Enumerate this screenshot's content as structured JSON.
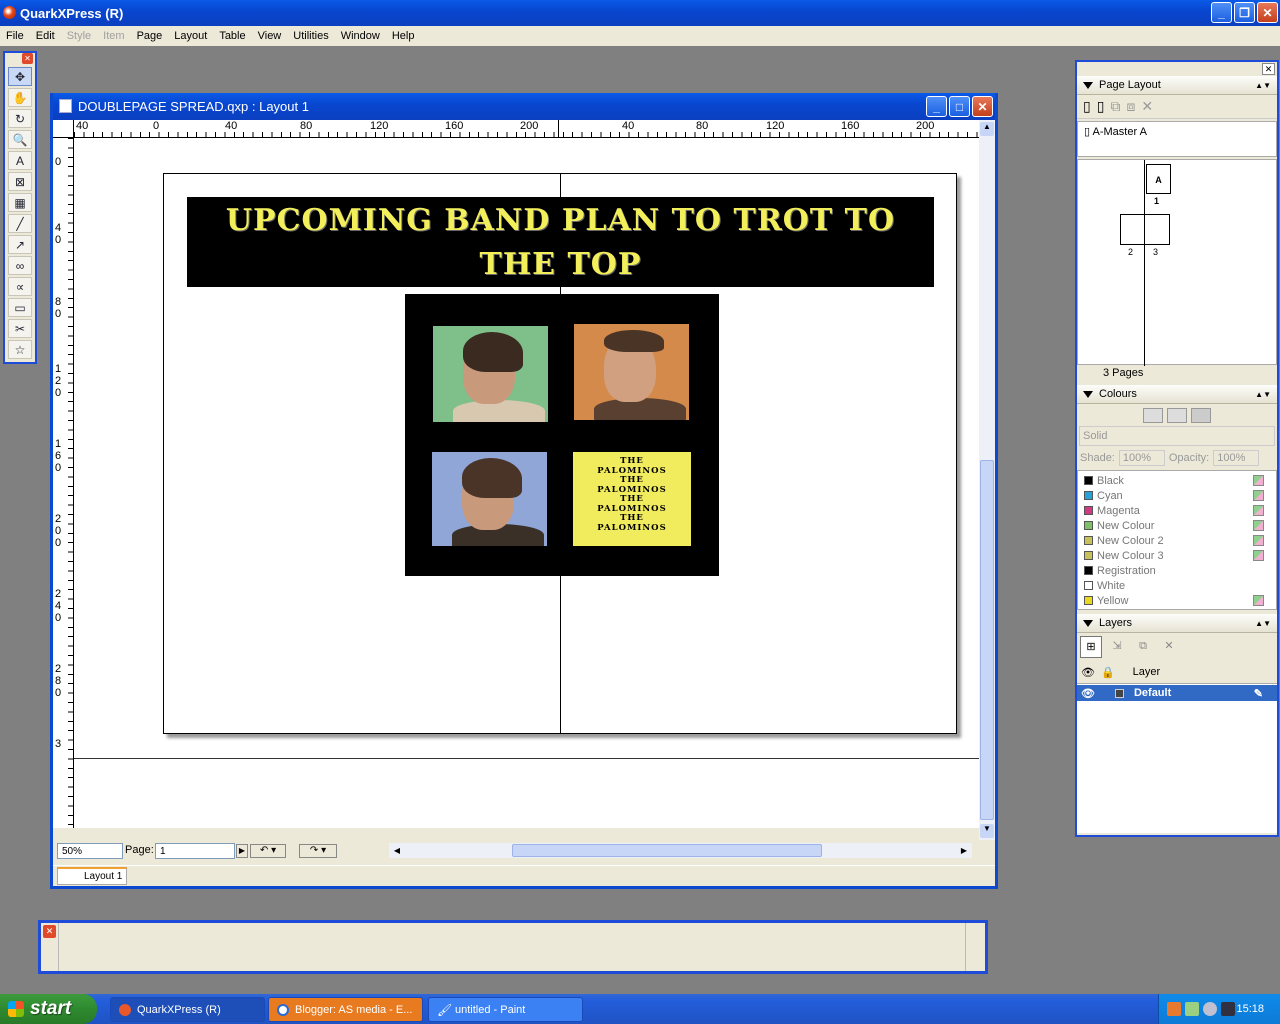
{
  "app": {
    "title": "QuarkXPress (R)"
  },
  "menu": [
    "File",
    "Edit",
    "Style",
    "Item",
    "Page",
    "Layout",
    "Table",
    "View",
    "Utilities",
    "Window",
    "Help"
  ],
  "menu_disabled": [
    "Style",
    "Item"
  ],
  "document": {
    "title": "DOUBLEPAGE SPREAD.qxp : Layout 1",
    "zoom": "50%",
    "page_label": "Page:",
    "page_value": "1",
    "tab": "Layout 1",
    "hruler_labels": [
      "40",
      "0",
      "40",
      "80",
      "120",
      "160",
      "200",
      "40",
      "80",
      "120",
      "160",
      "200"
    ],
    "vruler_labels": [
      "0",
      "4\n0",
      "8\n0",
      "1\n2\n0",
      "1\n6\n0",
      "2\n0\n0",
      "2\n4\n0",
      "2\n8\n0",
      "3"
    ]
  },
  "spread": {
    "headline": "Upcoming band plan to trot to the top",
    "palominos_text": "THE\nPALOMINOS\nTHE\nPALOMINOS\nTHE\nPALOMINOS\nTHE\nPALOMINOS",
    "photo_bg_colors": [
      "#7fbf8a",
      "#d48a4a",
      "#8fa6d6"
    ]
  },
  "page_layout": {
    "title": "Page Layout",
    "master": "A-Master A",
    "page_a_label": "A",
    "page_numbers": [
      "1",
      "2",
      "3"
    ],
    "page_count": "3 Pages"
  },
  "colours": {
    "title": "Colours",
    "mode": "Solid",
    "shade_label": "Shade:",
    "shade_value": "100%",
    "opacity_label": "Opacity:",
    "opacity_value": "100%",
    "items": [
      {
        "name": "Black",
        "swatch": "#000000",
        "global": true
      },
      {
        "name": "Cyan",
        "swatch": "#2aa0d8",
        "global": true
      },
      {
        "name": "Magenta",
        "swatch": "#d03a80",
        "global": true
      },
      {
        "name": "New Colour",
        "swatch": "#7fbf6a",
        "global": true
      },
      {
        "name": "New Colour 2",
        "swatch": "#c8c05a",
        "global": true
      },
      {
        "name": "New Colour 3",
        "swatch": "#c8c05a",
        "global": true
      },
      {
        "name": "Registration",
        "swatch": "#000000",
        "global": false
      },
      {
        "name": "White",
        "swatch": "#ffffff",
        "global": false
      },
      {
        "name": "Yellow",
        "swatch": "#e8d820",
        "global": true
      }
    ]
  },
  "layers": {
    "title": "Layers",
    "column": "Layer",
    "default_layer": "Default"
  },
  "taskbar": {
    "start": "start",
    "tasks": [
      "QuarkXPress (R)",
      "Blogger: AS media - E...",
      "untitled - Paint"
    ],
    "clock": "15:18"
  }
}
